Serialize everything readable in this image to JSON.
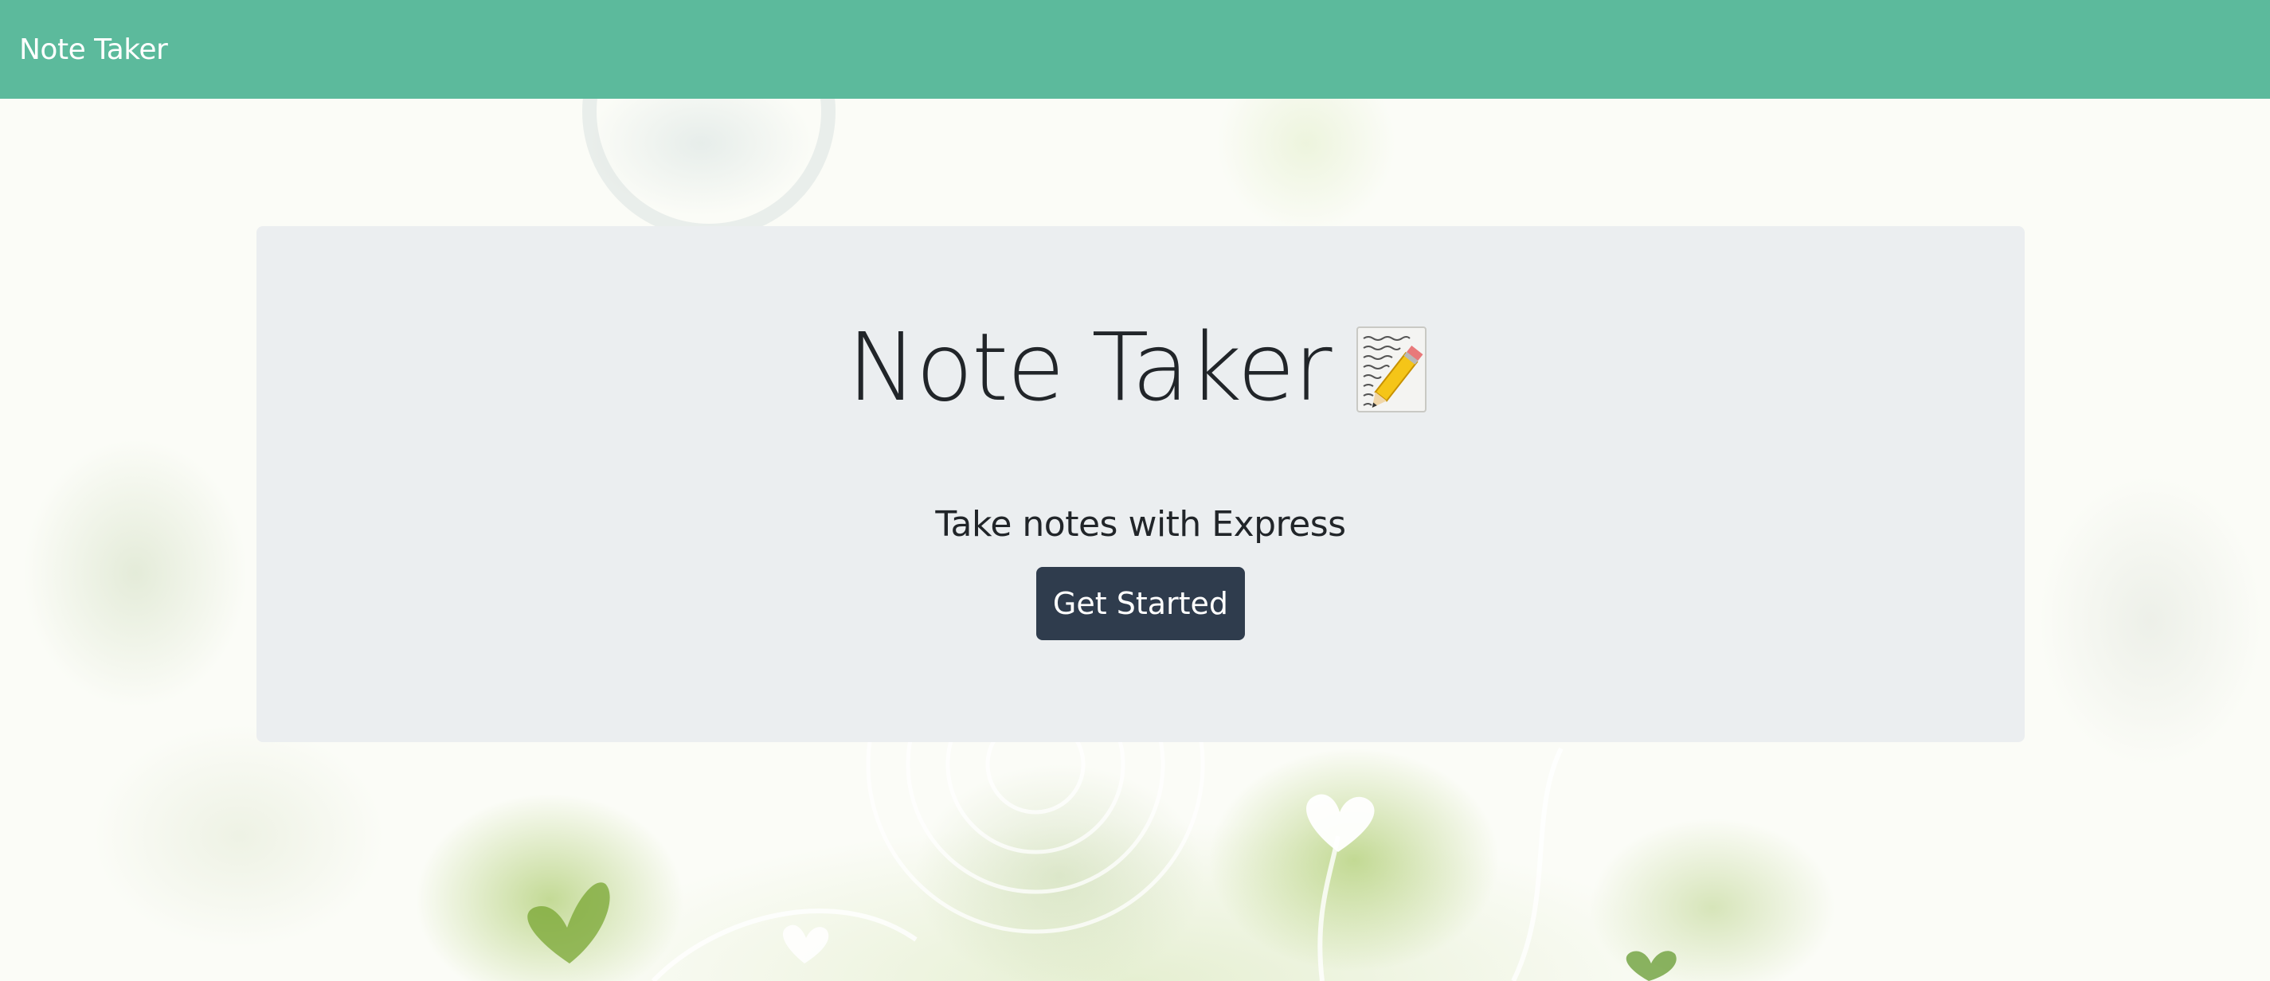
{
  "navbar": {
    "brand": "Note Taker",
    "background_color": "#5cba9c"
  },
  "hero": {
    "title": "Note Taker",
    "title_icon": "memo-icon",
    "subtitle": "Take notes with Express",
    "button_label": "Get Started",
    "button_color": "#2f3c4d",
    "panel_color": "#ebeef0"
  }
}
